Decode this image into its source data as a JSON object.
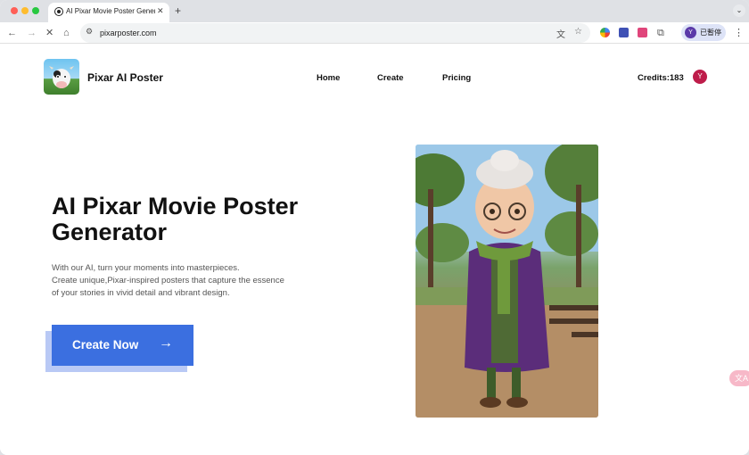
{
  "browser": {
    "tab_title": "AI Pixar Movie Poster Genera...",
    "tab_close": "✕",
    "new_tab": "+",
    "tab_menu": "⌄",
    "url": "pixarposter.com",
    "profile_initial": "Y",
    "profile_label": "已暫停",
    "icons": [
      "back-icon",
      "forward-icon",
      "stop-icon",
      "home-icon",
      "site-settings-icon",
      "translate-icon",
      "star-icon",
      "extensions-icon",
      "menu-icon"
    ]
  },
  "site": {
    "brand": "Pixar AI Poster",
    "nav": {
      "home": "Home",
      "create": "Create",
      "pricing": "Pricing"
    },
    "credits": "Credits:183",
    "user_initial": "Y"
  },
  "hero": {
    "title": "AI Pixar Movie Poster Generator",
    "description_lines": [
      "With our AI, turn your moments into masterpieces.",
      "Create unique,Pixar-inspired posters that capture the essence",
      "of your stories in vivid detail and vibrant design."
    ],
    "cta_label": "Create Now",
    "cta_arrow": "→"
  },
  "floating": {
    "label": "文A"
  },
  "colors": {
    "cta": "#3b6fe0",
    "cta_shadow": "#b9c9f5",
    "avatar": "#be1c4a"
  }
}
